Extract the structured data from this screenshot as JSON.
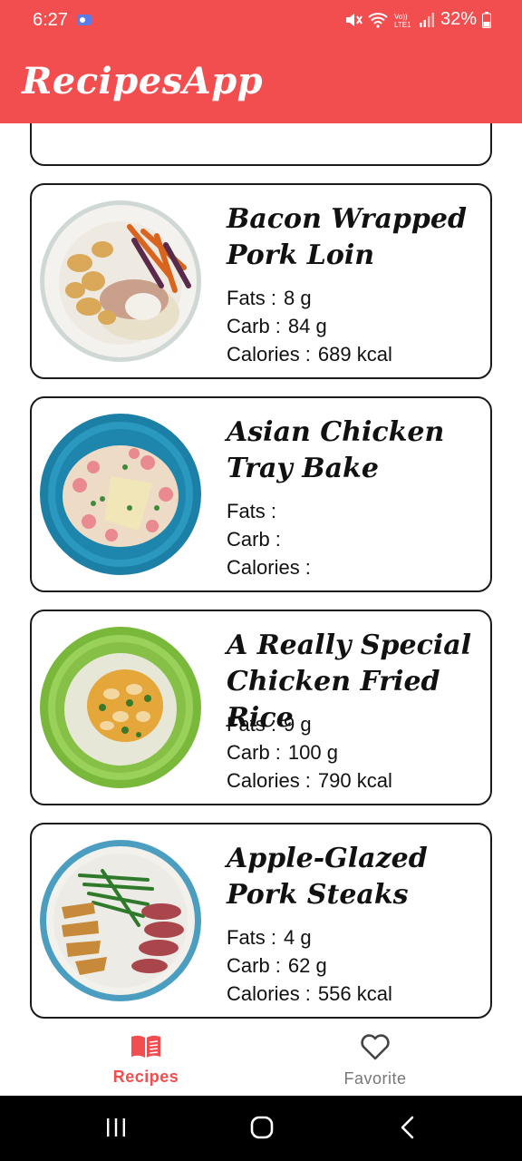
{
  "status_bar": {
    "time": "6:27",
    "battery": "32%"
  },
  "app": {
    "title": "RecipesApp"
  },
  "recipes": [
    {
      "title": "Bacon Wrapped Pork Loin",
      "fats_label": "Fats :",
      "fats": "8 g",
      "carb_label": "Carb :",
      "carb": "84 g",
      "calories_label": "Calories :",
      "calories": "689 kcal"
    },
    {
      "title": "Asian Chicken Tray Bake",
      "fats_label": "Fats :",
      "fats": "",
      "carb_label": "Carb :",
      "carb": "",
      "calories_label": "Calories :",
      "calories": ""
    },
    {
      "title": "A Really Special Chicken Fried Rice",
      "fats_label": "Fats :",
      "fats": "9 g",
      "carb_label": "Carb :",
      "carb": "100 g",
      "calories_label": "Calories :",
      "calories": "790 kcal"
    },
    {
      "title": "Apple-Glazed Pork Steaks",
      "fats_label": "Fats :",
      "fats": "4 g",
      "carb_label": "Carb :",
      "carb": "62 g",
      "calories_label": "Calories :",
      "calories": "556 kcal"
    }
  ],
  "bottom_nav": {
    "recipes_label": "Recipes",
    "favorite_label": "Favorite",
    "active": "Recipes"
  },
  "colors": {
    "primary": "#f24d4f",
    "active": "#f24d4f",
    "inactive": "#777777"
  }
}
